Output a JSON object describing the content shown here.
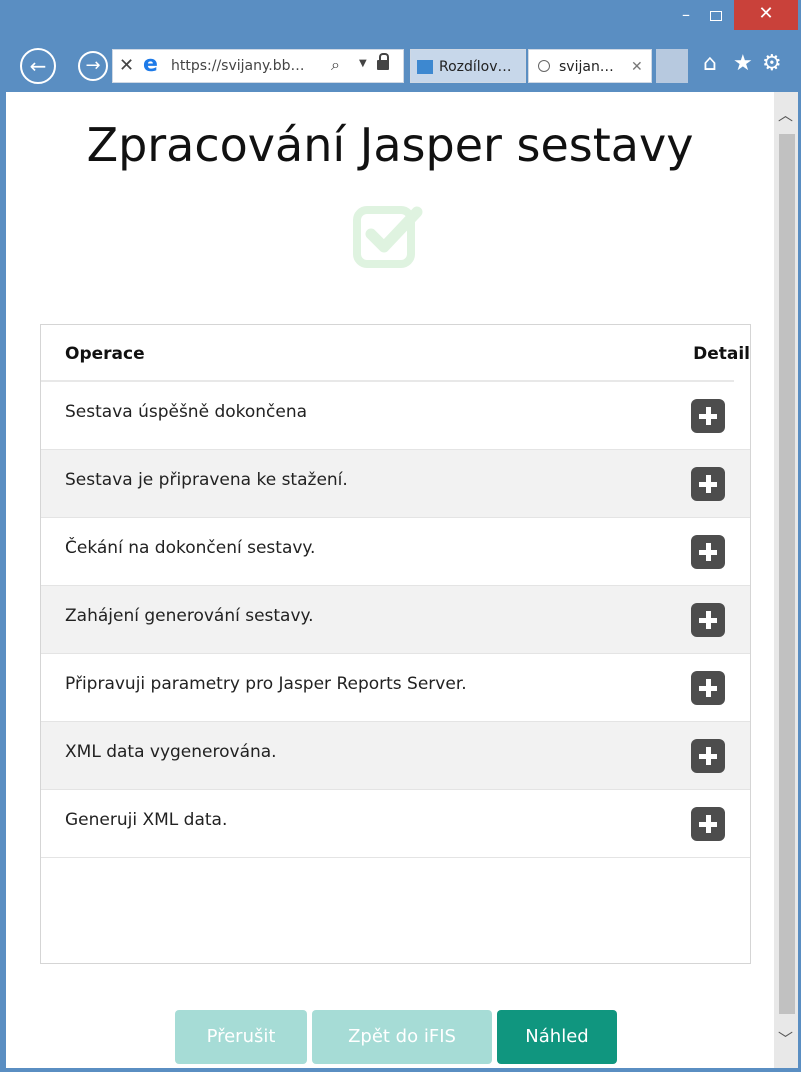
{
  "window": {
    "minimize_glyph": "–",
    "close_glyph": "✕"
  },
  "browser": {
    "url": "https://svijany.bb…",
    "tabs": [
      {
        "label": "Rozdílov…"
      },
      {
        "label": "svijan…",
        "close_glyph": "✕"
      }
    ],
    "icons": [
      "back-icon",
      "forward-icon",
      "stop-icon",
      "ie-logo-icon",
      "search-icon",
      "dropdown-icon",
      "lock-icon",
      "home-icon",
      "favorites-star-icon",
      "settings-gear-icon"
    ]
  },
  "page": {
    "title": "Zpracování Jasper sestavy",
    "status_icon": "checkbox-check-icon",
    "accent_color": "#10967f",
    "check_color": "#dff3e0"
  },
  "table": {
    "headers": {
      "operation": "Operace",
      "detail": "Detail"
    },
    "rows": [
      {
        "text": "Sestava úspěšně dokončena"
      },
      {
        "text": "Sestava je připravena ke stažení."
      },
      {
        "text": "Čekání na dokončení sestavy."
      },
      {
        "text": "Zahájení generování sestavy."
      },
      {
        "text": "Připravuji parametry pro Jasper Reports Server."
      },
      {
        "text": "XML data vygenerována."
      },
      {
        "text": "Generuji XML data."
      }
    ]
  },
  "buttons": {
    "cancel": "Přerušit",
    "back": "Zpět do iFIS",
    "preview": "Náhled"
  }
}
